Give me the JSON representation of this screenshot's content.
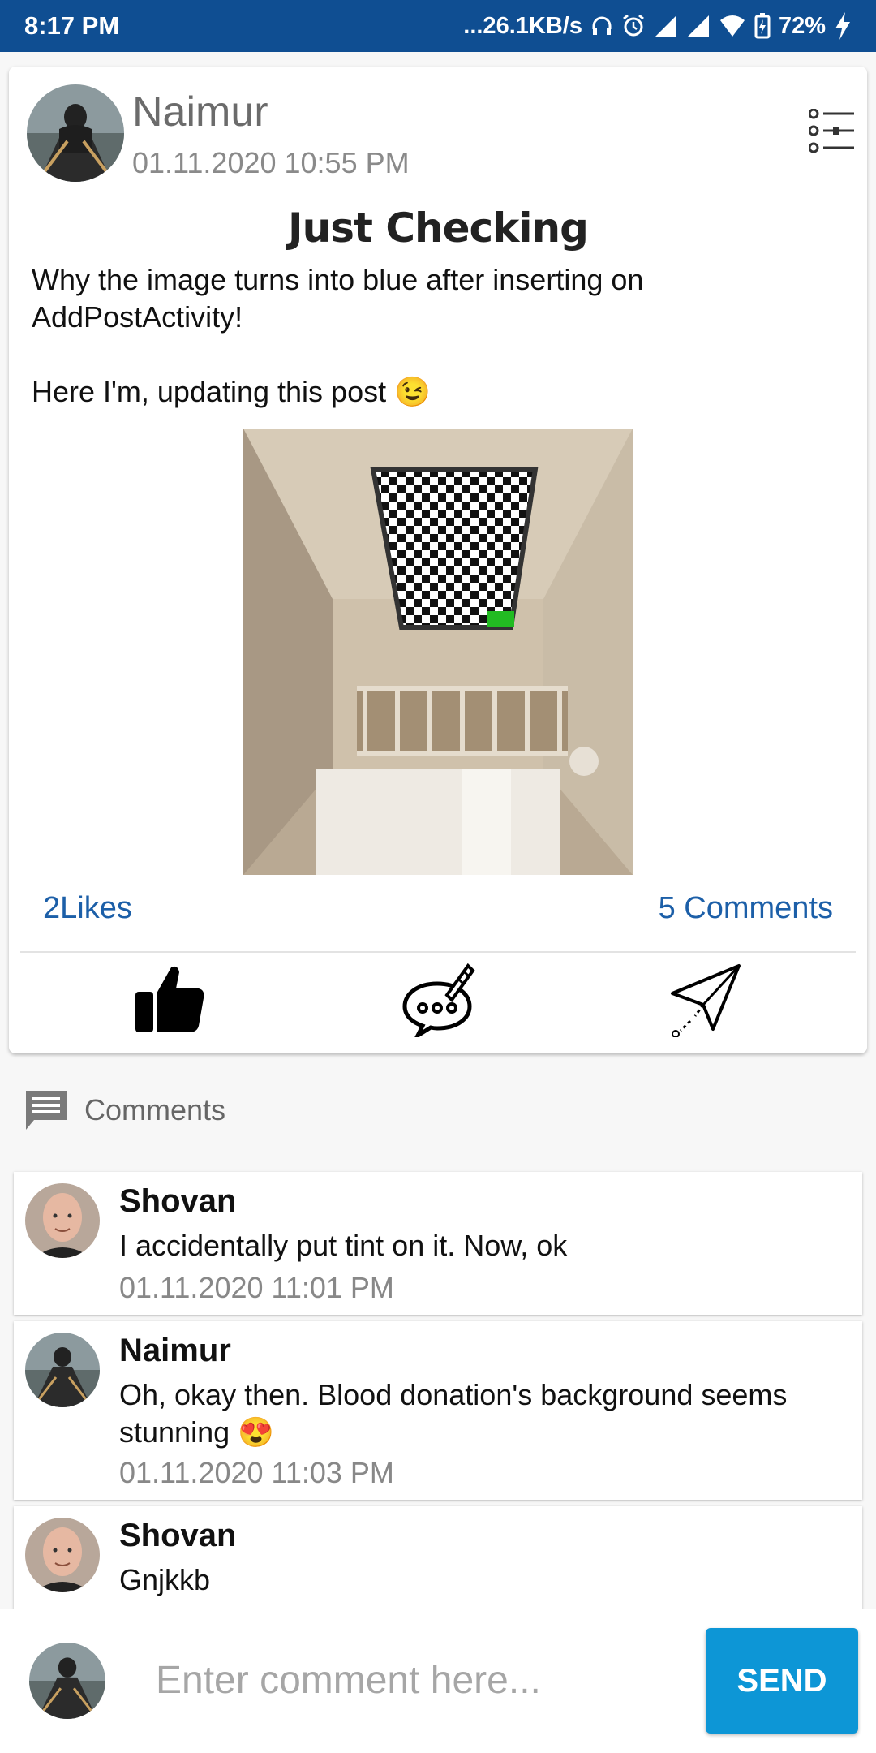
{
  "status_bar": {
    "time": "8:17 PM",
    "net_speed": "...26.1KB/s",
    "battery": "72%"
  },
  "post": {
    "author": "Naimur",
    "timestamp": "01.11.2020 10:55 PM",
    "title": "Just Checking",
    "body": "Why the image turns into blue after inserting on AddPostActivity!\n\nHere I'm, updating this post 😉",
    "likes": "2Likes",
    "comments": "5 Comments"
  },
  "comments_section": {
    "label": "Comments",
    "items": [
      {
        "name": "Shovan",
        "text": "I accidentally put tint on it. Now, ok",
        "time": "01.11.2020 11:01 PM"
      },
      {
        "name": "Naimur",
        "text": "Oh, okay then. Blood donation's background seems stunning 😍",
        "time": "01.11.2020 11:03 PM"
      },
      {
        "name": "Shovan",
        "text": "Gnjkkb",
        "time": ""
      }
    ]
  },
  "composer": {
    "placeholder": "Enter comment here...",
    "send_label": "SEND"
  },
  "colors": {
    "status_bar": "#0f4e92",
    "link_blue": "#1c5fa8",
    "send_button": "#0d96d6"
  }
}
